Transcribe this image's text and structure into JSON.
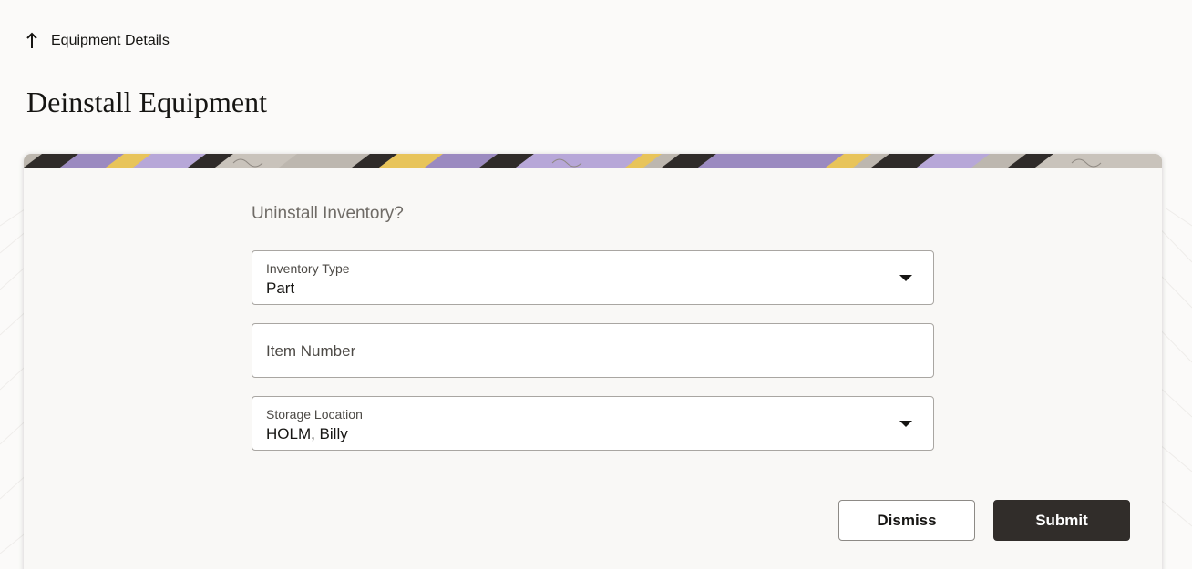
{
  "breadcrumb": {
    "label": "Equipment Details",
    "icon": "arrow-up-icon"
  },
  "page": {
    "title": "Deinstall Equipment"
  },
  "form": {
    "heading": "Uninstall Inventory?",
    "inventory_type": {
      "label": "Inventory Type",
      "value": "Part",
      "icon": "caret-down-icon"
    },
    "item_number": {
      "placeholder": "Item Number"
    },
    "storage_location": {
      "label": "Storage Location",
      "value": "HOLM, Billy",
      "icon": "caret-down-icon"
    }
  },
  "actions": {
    "dismiss_label": "Dismiss",
    "submit_label": "Submit"
  },
  "colors": {
    "primary_button": "#312d2a",
    "background": "#fbfaf9",
    "banner_purple": "#9b8ac0",
    "banner_yellow": "#e8c45a"
  }
}
